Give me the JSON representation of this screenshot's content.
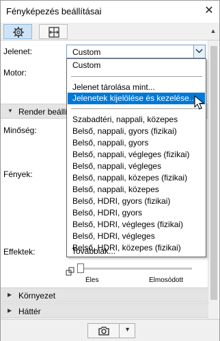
{
  "window": {
    "title": "Fényképezés beállításai",
    "close_symbol": "✕"
  },
  "toolbar": {
    "tabs": [
      {
        "icon": "gear-icon",
        "active": true
      },
      {
        "icon": "grid-icon",
        "active": false
      }
    ],
    "scroll_up_symbol": "▲"
  },
  "form": {
    "scene_label": "Jelenet:",
    "scene_value": "Custom",
    "engine_label": "Motor:",
    "render_section_label": "Render beállí",
    "quality_label": "Minőség:",
    "lights_label": "Fények:",
    "effects_label": "Effektek:",
    "pct_symbol": "%"
  },
  "slider": {
    "left_label": "Éles",
    "right_label": "Elmosódott"
  },
  "dropdown": {
    "items": [
      "Custom",
      "Jelenet tárolása mint...",
      "Jelenetek kijelölése és kezelése...",
      "Szabadtéri, nappali, közepes",
      "Belső, nappali, gyors (fizikai)",
      "Belső, nappali, gyors",
      "Belső, nappali, végleges (fizikai)",
      "Belső, nappali, végleges",
      "Belső, nappali, közepes (fizikai)",
      "Belső, nappali, közepes",
      "Belső, HDRI, gyors (fizikai)",
      "Belső, HDRI, gyors",
      "Belső, HDRI, végleges (fizikai)",
      "Belső, HDRI, végleges",
      "Belső, HDRI, közepes (fizikai)",
      "Továbbiak..."
    ],
    "highlighted_index": 2
  },
  "sections": {
    "environment": "Környezet",
    "background": "Háttér"
  },
  "colors": {
    "highlight": "#0078d7",
    "active_tab": "#cfe3f7"
  }
}
